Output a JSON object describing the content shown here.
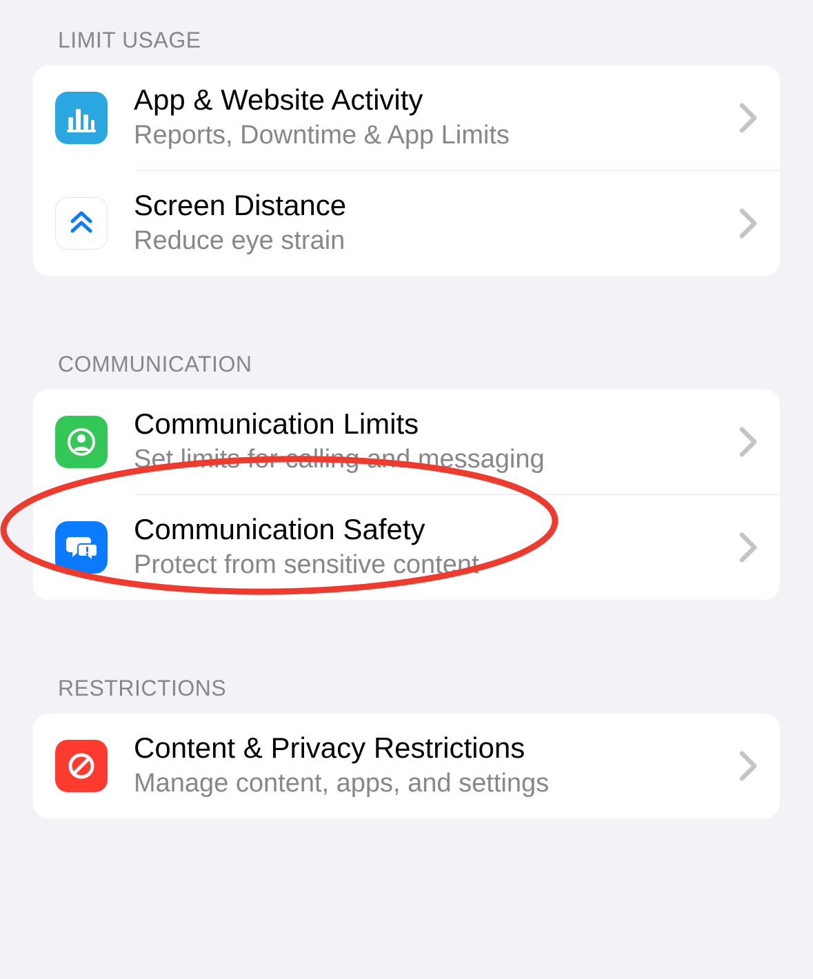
{
  "sections": [
    {
      "header": "LIMIT USAGE",
      "items": [
        {
          "icon": "bar-chart-icon",
          "title": "App & Website Activity",
          "subtitle": "Reports, Downtime & App Limits"
        },
        {
          "icon": "chevrons-up-icon",
          "title": "Screen Distance",
          "subtitle": "Reduce eye strain"
        }
      ]
    },
    {
      "header": "COMMUNICATION",
      "items": [
        {
          "icon": "person-circle-icon",
          "title": "Communication Limits",
          "subtitle": "Set limits for calling and messaging"
        },
        {
          "icon": "chat-alert-icon",
          "title": "Communication Safety",
          "subtitle": "Protect from sensitive content"
        }
      ]
    },
    {
      "header": "RESTRICTIONS",
      "items": [
        {
          "icon": "prohibit-icon",
          "title": "Content & Privacy Restrictions",
          "subtitle": "Manage content, apps, and settings"
        }
      ]
    }
  ],
  "colors": {
    "bg_activity": "#2aa7e0",
    "bg_distance": "#ffffff",
    "fg_distance": "#0a7aff",
    "bg_commlimits": "#33c758",
    "bg_commsafety": "#0a7aff",
    "bg_restrict": "#ff3b30",
    "annotation": "#ef3a2e"
  }
}
